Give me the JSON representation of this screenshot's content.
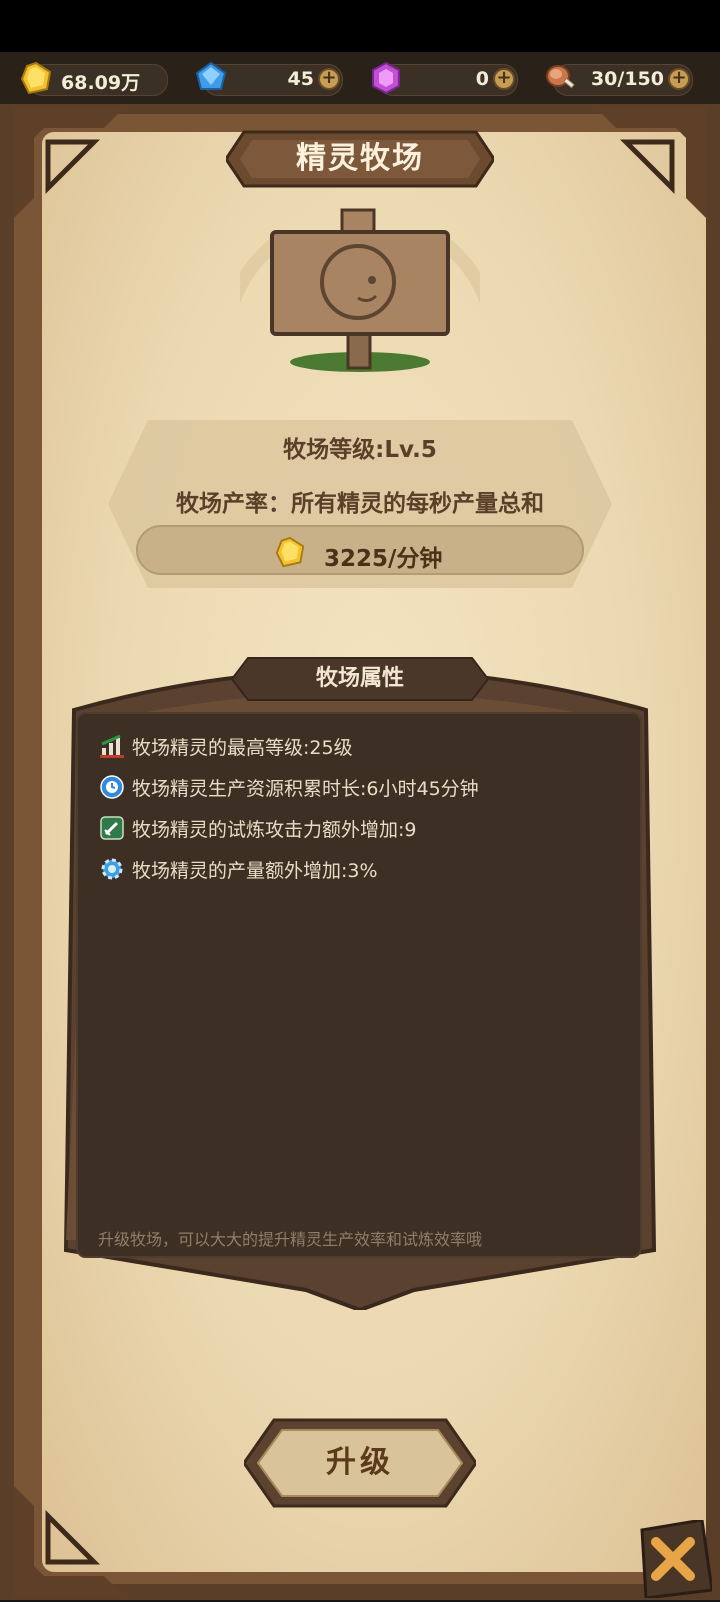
{
  "resources": {
    "gold": {
      "value": "68.09万",
      "icon": "gold-nugget-icon",
      "color": "#f2c230"
    },
    "gem": {
      "value": "45",
      "icon": "blue-diamond-icon",
      "color": "#4aa8f0"
    },
    "crystal": {
      "value": "0",
      "icon": "purple-crystal-icon",
      "color": "#c95ad8"
    },
    "food": {
      "value": "30/150",
      "icon": "meat-icon",
      "color": "#c9774a"
    },
    "plus_label": "+"
  },
  "title": "精灵牧场",
  "ranch": {
    "level_text": "牧场等级:Lv.5",
    "rate_text": "牧场产率：所有精灵的每秒产量总和",
    "output_text": "3225/分钟"
  },
  "attributes": {
    "title": "牧场属性",
    "items": [
      {
        "icon": "bar-chart-icon",
        "text": "牧场精灵的最高等级:25级"
      },
      {
        "icon": "clock-icon",
        "text": "牧场精灵生产资源积累时长:6小时45分钟"
      },
      {
        "icon": "sword-icon",
        "text": "牧场精灵的试炼攻击力额外增加:9"
      },
      {
        "icon": "gear-icon",
        "text": "牧场精灵的产量额外增加:3%"
      }
    ],
    "hint": "升级牧场，可以大大的提升精灵生产效率和试炼效率哦"
  },
  "upgrade_label": "升级",
  "close_icon": "close-x-icon"
}
